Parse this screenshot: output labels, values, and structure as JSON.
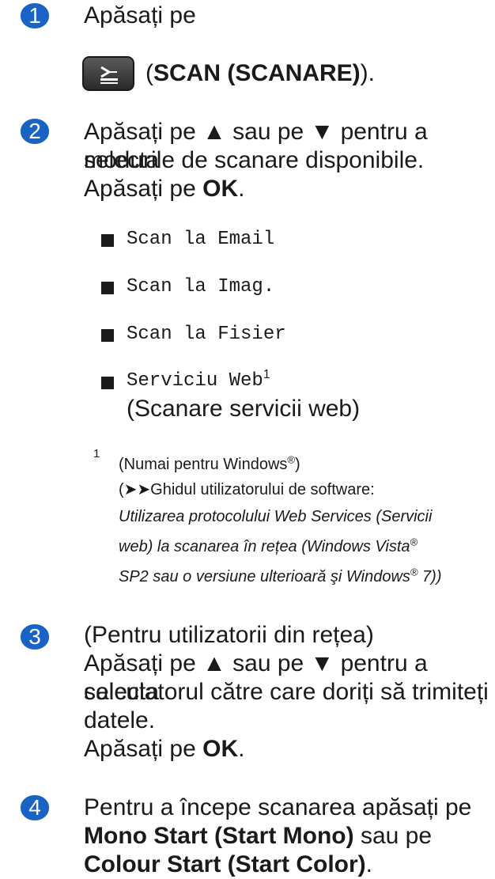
{
  "steps": {
    "s1": {
      "num": "1",
      "text": "Apăsați pe",
      "button_open": "(",
      "button_label": "SCAN (SCANARE)",
      "button_close": ")."
    },
    "s2": {
      "num": "2",
      "line1": "Apăsați pe ▲ sau pe ▼ pentru a selecta",
      "line2": "modurile de scanare disponibile.",
      "line3_pre": "Apăsați pe ",
      "line3_bold": "OK",
      "line3_post": "."
    },
    "s3": {
      "num": "3",
      "line1": "(Pentru utilizatorii din rețea)",
      "line2": "Apăsați pe ▲ sau pe ▼ pentru a selecta",
      "line3": "calculatorul către care doriți să trimiteți",
      "line4": "datele.",
      "line5_pre": "Apăsați pe ",
      "line5_bold": "OK",
      "line5_post": "."
    },
    "s4": {
      "num": "4",
      "line1": "Pentru a începe scanarea apăsați pe",
      "line2_bold": "Mono Start (Start Mono)",
      "line2_post": " sau pe",
      "line3_bold": "Colour Start (Start Color)",
      "line3_post": "."
    }
  },
  "modes": {
    "m1": "Scan la Email",
    "m2": "Scan la Imag.",
    "m3": "Scan la Fisier",
    "m4": "Serviciu Web",
    "m4_sup": "1",
    "m4_sub": "(Scanare servicii web)"
  },
  "footnote": {
    "num": "1",
    "line1_pre": "(Numai pentru Windows",
    "reg": "®",
    "line1_post": ")",
    "line2": "(➤➤Ghidul utilizatorului de software:",
    "line3": "Utilizarea protocolului Web Services (Servicii",
    "line4_pre": "web) la scanarea în rețea (Windows Vista",
    "line5_pre": "SP2 sau o versiune ulterioară şi Windows",
    "line5_post": " 7))"
  }
}
